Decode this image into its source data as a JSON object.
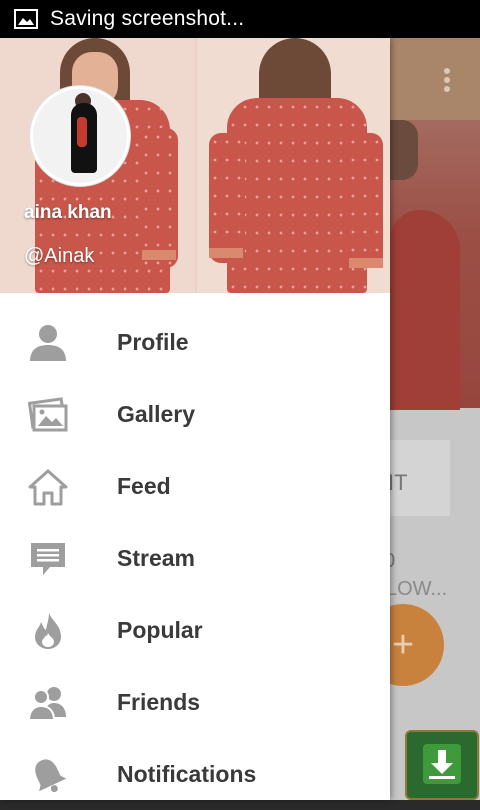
{
  "status_bar": {
    "text": "Saving screenshot...",
    "icon": "image-icon"
  },
  "drawer": {
    "user": {
      "name": "aina khan",
      "handle": "@Ainak"
    },
    "menu": [
      {
        "label": "Profile",
        "icon": "person-icon"
      },
      {
        "label": "Gallery",
        "icon": "gallery-icon"
      },
      {
        "label": "Feed",
        "icon": "home-icon"
      },
      {
        "label": "Stream",
        "icon": "chat-bubble-icon"
      },
      {
        "label": "Popular",
        "icon": "flame-icon"
      },
      {
        "label": "Friends",
        "icon": "friends-icon"
      },
      {
        "label": "Notifications",
        "icon": "bell-icon"
      }
    ]
  },
  "background": {
    "card_text": "IT",
    "count_text": "0",
    "follow_text": "LOW...",
    "fab_label": "+",
    "toolbar_color": "#a9866a",
    "fab_color": "#c9823e"
  },
  "colors": {
    "drawer_bg": "#ffffff",
    "label_color": "#3a3a3a",
    "icon_color": "#9e9e9e",
    "status_bar": "#000000"
  }
}
